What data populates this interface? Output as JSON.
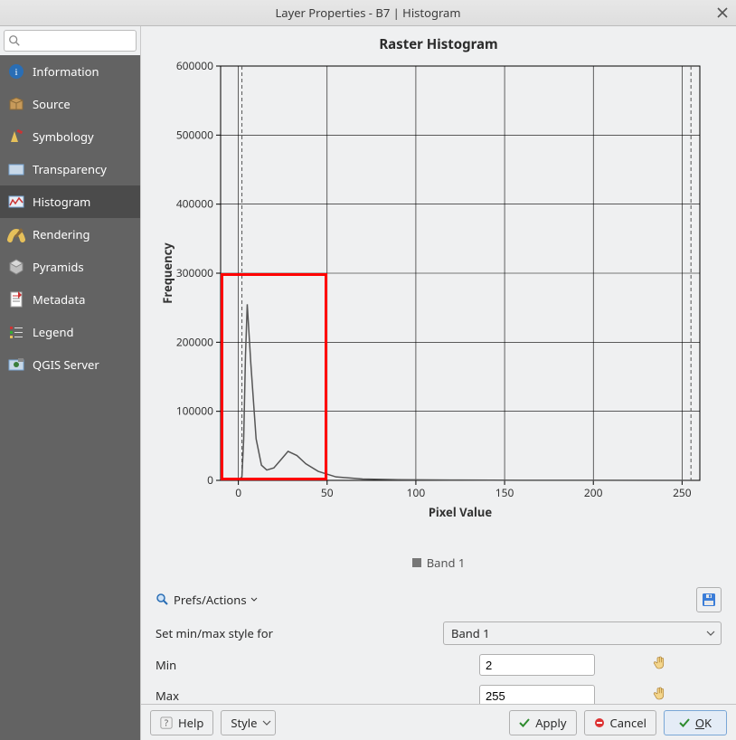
{
  "window": {
    "title": "Layer Properties - B7 | Histogram"
  },
  "sidebar": {
    "items": [
      {
        "label": "Information"
      },
      {
        "label": "Source"
      },
      {
        "label": "Symbology"
      },
      {
        "label": "Transparency"
      },
      {
        "label": "Histogram"
      },
      {
        "label": "Rendering"
      },
      {
        "label": "Pyramids"
      },
      {
        "label": "Metadata"
      },
      {
        "label": "Legend"
      },
      {
        "label": "QGIS Server"
      }
    ],
    "selected_index": 4
  },
  "prefs_label": "Prefs/Actions",
  "setminmax_label": "Set min/max style for",
  "band_combo": {
    "selected": "Band 1"
  },
  "min_label": "Min",
  "max_label": "Max",
  "min_value": "2",
  "max_value": "255",
  "buttons": {
    "help": "Help",
    "style": "Style",
    "apply": "Apply",
    "cancel": "Cancel",
    "ok": "OK"
  },
  "chart_data": {
    "type": "line",
    "title": "Raster Histogram",
    "xlabel": "Pixel Value",
    "ylabel": "Frequency",
    "xlim": [
      -10,
      260
    ],
    "ylim": [
      0,
      600000
    ],
    "x_ticks": [
      0,
      50,
      100,
      150,
      200,
      250
    ],
    "y_ticks": [
      0,
      100000,
      200000,
      300000,
      400000,
      500000,
      600000
    ],
    "legend": [
      "Band 1"
    ],
    "series": [
      {
        "name": "Band 1",
        "x": [
          0,
          2,
          3,
          4,
          5,
          7,
          10,
          13,
          16,
          20,
          24,
          28,
          33,
          38,
          45,
          55,
          70,
          90,
          120,
          160,
          200,
          255
        ],
        "y": [
          0,
          5000,
          60000,
          180000,
          255000,
          170000,
          60000,
          22000,
          15000,
          18000,
          30000,
          42000,
          36000,
          24000,
          13000,
          5000,
          2000,
          1000,
          500,
          200,
          100,
          0
        ]
      }
    ],
    "vlines": [
      2,
      255
    ],
    "highlight_box": {
      "x0": -10,
      "x1": 50,
      "y0": 0,
      "y1": 300000
    }
  }
}
